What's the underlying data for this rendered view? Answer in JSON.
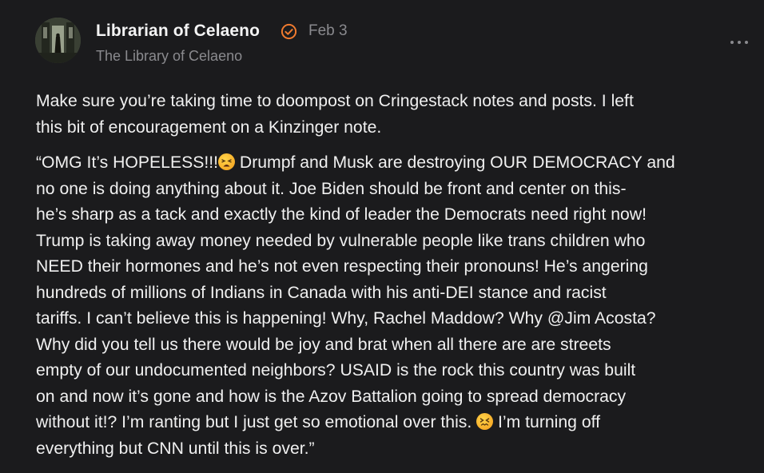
{
  "author": {
    "name": "Librarian of Celaeno",
    "date": "Feb 3",
    "publication": "The Library of Celaeno",
    "verified_icon": "verified-check-icon",
    "accent_color": "#f07b2f"
  },
  "menu": {
    "icon": "more-horizontal-icon"
  },
  "post": {
    "paragraph1": {
      "lines": [
        "Make sure you’re taking time to doompost on Cringestack notes and posts. I left",
        "this bit of encouragement on a Kinzinger note."
      ]
    },
    "paragraph2": {
      "line1_a": "“OMG It’s HOPELESS!!!",
      "line1_emoji": "tired-face-emoji",
      "line1_b": " Drumpf and Musk are destroying OUR DEMOCRACY and",
      "lines_middle": [
        "no one is doing anything about it. Joe Biden should be front and center on this-",
        "he’s sharp as a tack and exactly the kind of leader the Democrats need right now!",
        "Trump is taking away money needed by vulnerable people like trans children who",
        "NEED their hormones and he’s not even respecting their pronouns! He’s angering",
        "hundreds of millions of Indians in Canada with his anti-DEI stance and racist",
        "tariffs. I can’t believe this is happening! Why, Rachel Maddow? Why @Jim Acosta?",
        "Why did you tell us there would be joy and brat when all there are are streets",
        "empty of our undocumented neighbors? USAID is the rock this country was built",
        "on and now it’s gone and how is the Azov Battalion going to spread democracy"
      ],
      "line11_a": "without it!? I’m ranting but I just get so emotional over this. ",
      "line11_emoji": "confounded-face-emoji",
      "line11_b": " I’m turning off",
      "line12": "everything but CNN until this is over.”"
    }
  }
}
